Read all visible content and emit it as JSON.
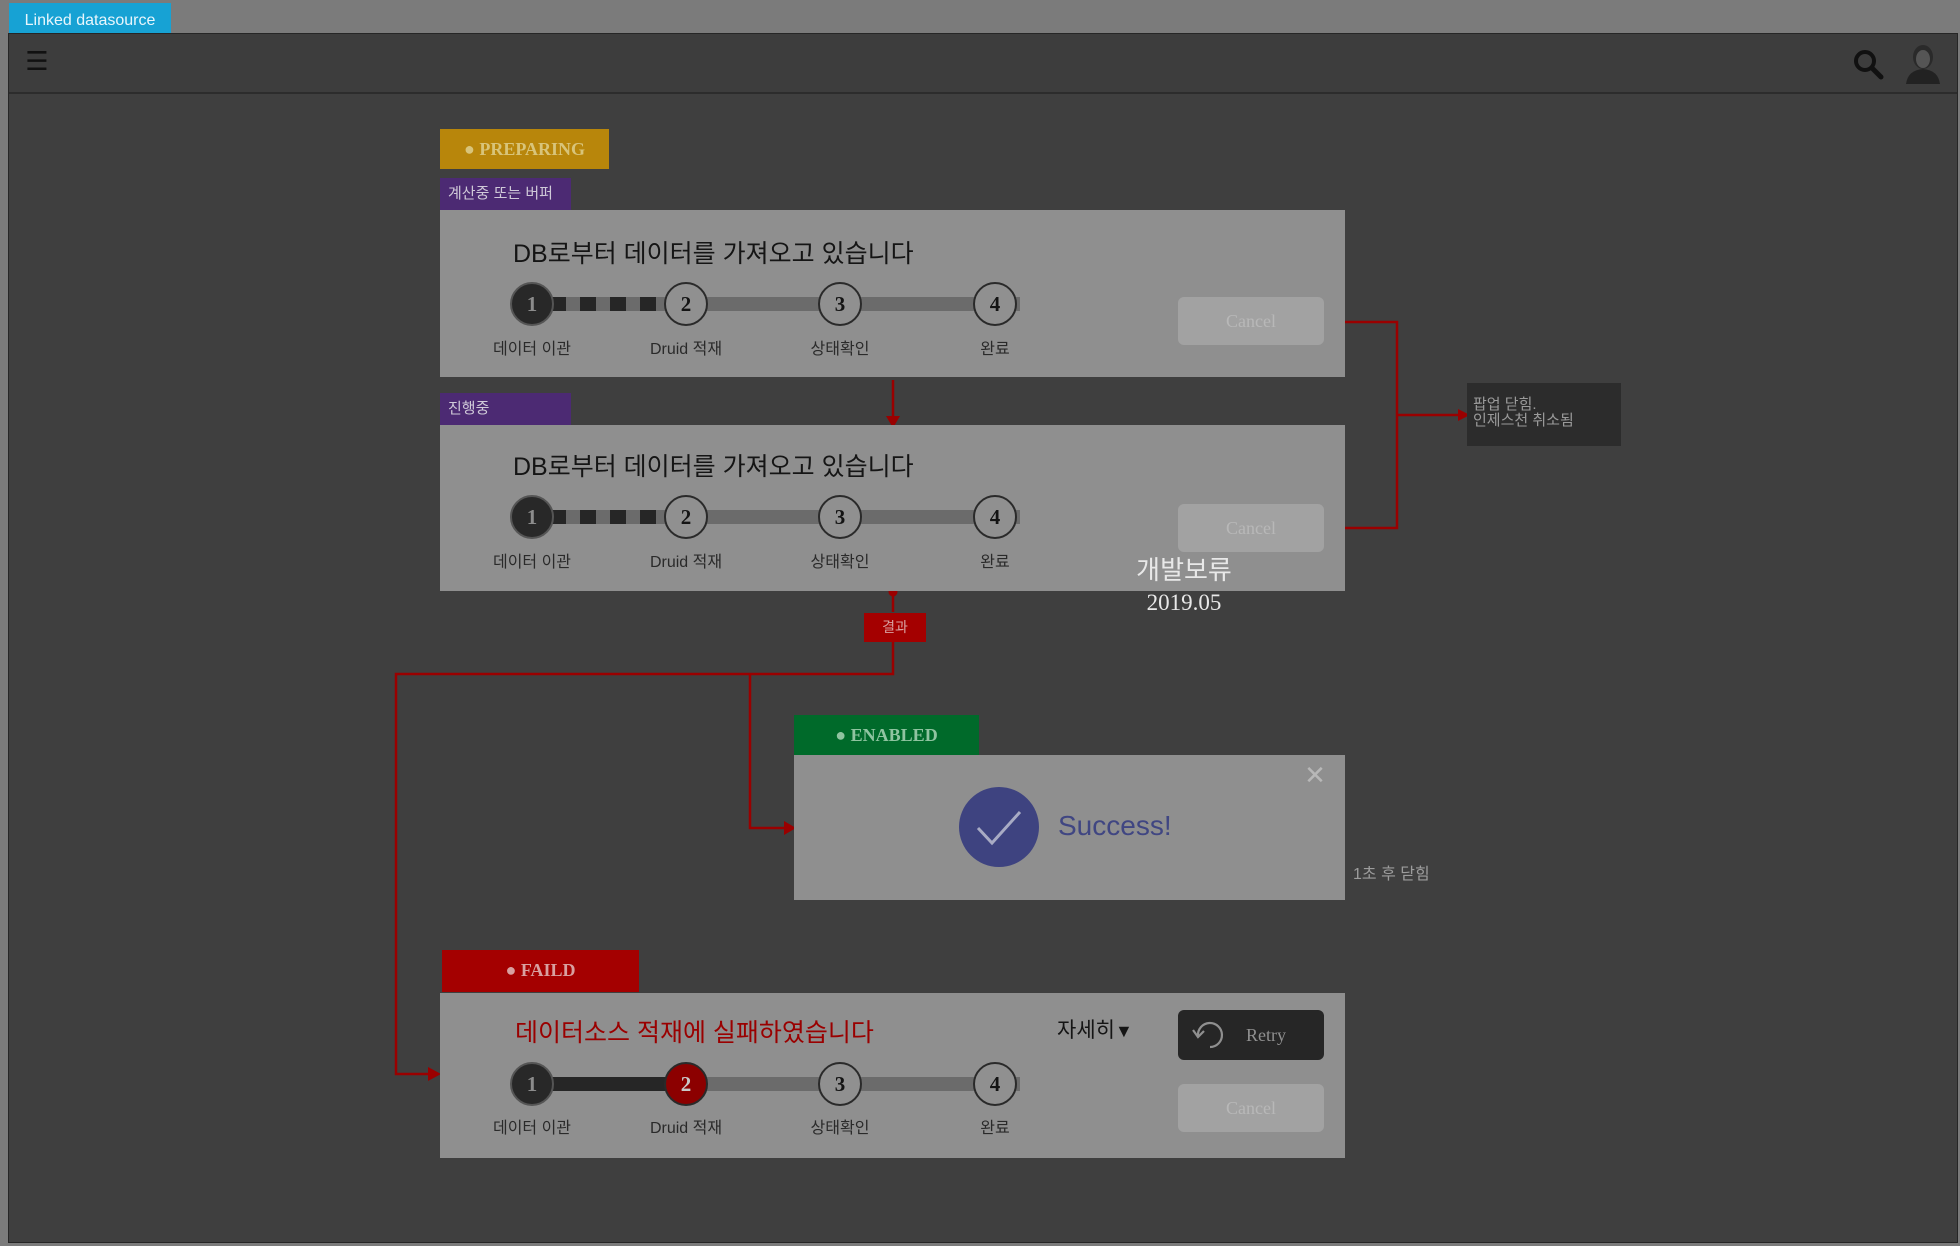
{
  "window": {
    "tab_title": "Linked datasource"
  },
  "header": {
    "menu_icon": "hamburger-icon",
    "search_icon": "search-icon",
    "avatar": "user-avatar"
  },
  "steps": {
    "s1": {
      "num": "1",
      "label": "데이터 이관"
    },
    "s2": {
      "num": "2",
      "label": "Druid 적재"
    },
    "s3": {
      "num": "3",
      "label": "상태확인"
    },
    "s4": {
      "num": "4",
      "label": "완료"
    }
  },
  "preparing": {
    "status": "● PREPARING",
    "status_color": "#b8860b",
    "tag": "계산중 또는 버퍼",
    "heading": "DB로부터 데이터를 가져오고 있습니다",
    "cancel": "Cancel"
  },
  "progress": {
    "tag": "진행중",
    "heading": "DB로부터 데이터를 가져오고 있습니다",
    "cancel": "Cancel"
  },
  "popup_note": {
    "line1": "팝업 닫힘.",
    "line2": "인제스천 취소됨"
  },
  "dev_note": {
    "line1": "개발보류",
    "line2": "2019.05"
  },
  "result_tag": "결과",
  "enabled": {
    "status": "● ENABLED",
    "status_color": "#006a2a",
    "message": "Success!",
    "close_note": "1초 후 닫힘"
  },
  "failed": {
    "status": "● FAILD",
    "status_color": "#a40000",
    "heading": "데이터소스 적재에 실패하였습니다",
    "detail": "자세히",
    "retry": "Retry",
    "cancel": "Cancel"
  }
}
